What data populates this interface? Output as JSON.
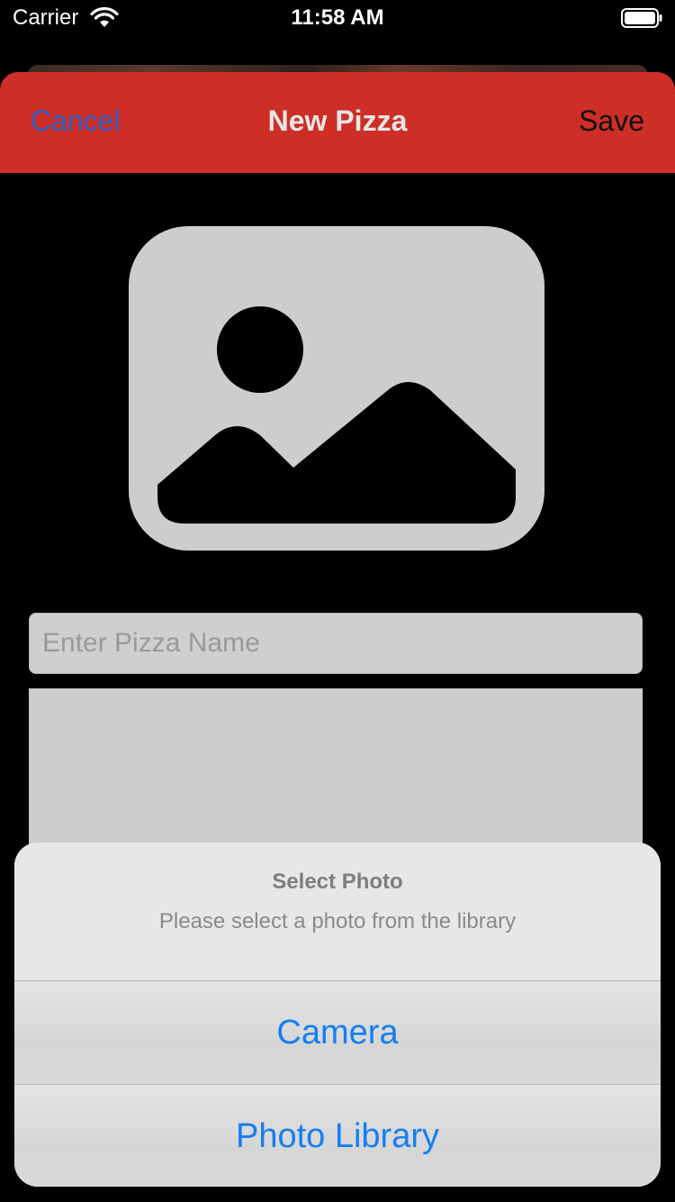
{
  "status_bar": {
    "carrier": "Carrier",
    "time": "11:58 AM",
    "wifi_icon": "wifi-icon",
    "battery_icon": "battery-icon"
  },
  "nav_bar": {
    "cancel_label": "Cancel",
    "title": "New Pizza",
    "save_label": "Save",
    "background_color": "#cd2e26",
    "cancel_color": "#2a5ec8"
  },
  "form": {
    "photo_icon": "photo-placeholder-icon",
    "name_field": {
      "value": "",
      "placeholder": "Enter Pizza Name"
    }
  },
  "action_sheet": {
    "title": "Select Photo",
    "message": "Please select a photo from the library",
    "actions": [
      {
        "label": "Camera"
      },
      {
        "label": "Photo Library"
      }
    ],
    "action_color": "#157ef3"
  }
}
